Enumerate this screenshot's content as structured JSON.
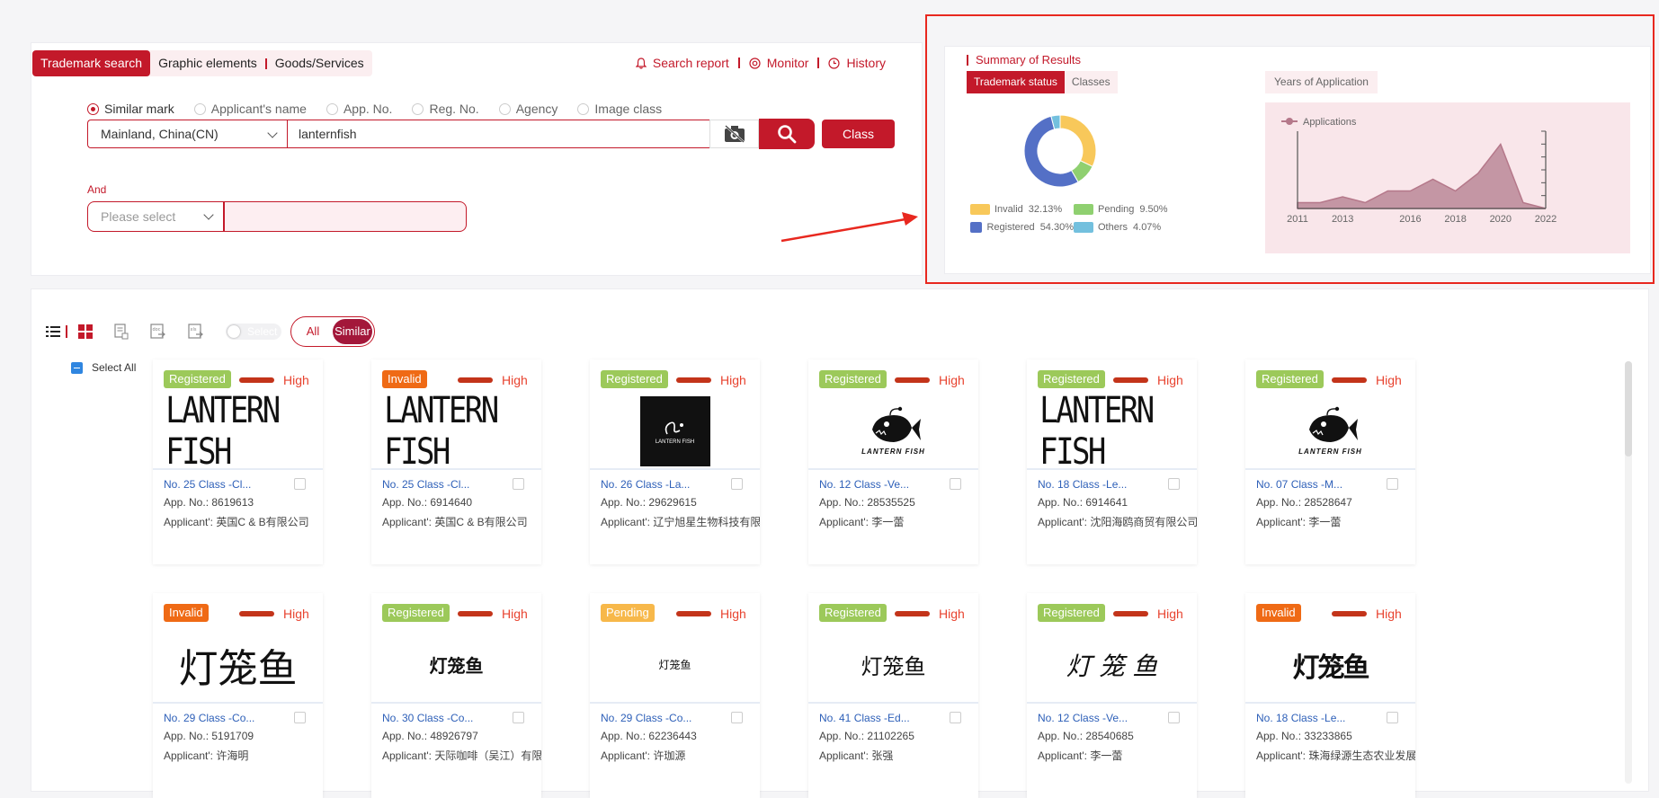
{
  "search": {
    "tabs": [
      "Trademark search",
      "Graphic elements",
      "Goods/Services"
    ],
    "links": [
      "Search report",
      "Monitor",
      "History"
    ],
    "radios": [
      "Similar mark",
      "Applicant's name",
      "App. No.",
      "Reg. No.",
      "Agency",
      "Image class"
    ],
    "region": "Mainland, China(CN)",
    "keyword": "lanternfish",
    "class_button": "Class",
    "and_label": "And",
    "and_placeholder": "Please select"
  },
  "summary": {
    "title": "Summary of Results",
    "tabs": [
      "Trademark status",
      "Classes"
    ],
    "years_tab": "Years of Application",
    "donut": [
      {
        "label": "Invalid",
        "pct": "32.13%",
        "value": 32.13,
        "color": "#f8c85a"
      },
      {
        "label": "Pending",
        "pct": "9.50%",
        "value": 9.5,
        "color": "#8fd070"
      },
      {
        "label": "Registered",
        "pct": "54.30%",
        "value": 54.3,
        "color": "#5470c6"
      },
      {
        "label": "Others",
        "pct": "4.07%",
        "value": 4.07,
        "color": "#73c0de"
      }
    ]
  },
  "chart_data": {
    "type": "area",
    "series": [
      {
        "name": "Applications",
        "values": [
          1,
          1,
          2,
          1,
          3,
          3,
          5,
          3,
          6,
          11,
          1
        ]
      }
    ],
    "x": [
      2011,
      2012,
      2013,
      2014,
      2015,
      2016,
      2017,
      2018,
      2019,
      2020,
      2021,
      2022
    ],
    "xticks": [
      "2011",
      "2013",
      "2016",
      "2018",
      "2020",
      "2022"
    ],
    "color": "#b5788a"
  },
  "results": {
    "filter": [
      "All",
      "Similar"
    ],
    "toggle_label": "Select",
    "select_all": "Select All",
    "high_label": "High",
    "cards": [
      {
        "status": "Registered",
        "color": "#9cc95a",
        "image": "LANTERN FISH",
        "kind": "text-lf",
        "cls": "No. 25 Class -Cl...",
        "app": "App. No.: 8619613",
        "applicant": "Applicant': 英国C & B有限公司"
      },
      {
        "status": "Invalid",
        "color": "#ef6a15",
        "image": "LANTERN FISH",
        "kind": "text-lf",
        "cls": "No. 25 Class -Cl...",
        "app": "App. No.: 6914640",
        "applicant": "Applicant': 英国C & B有限公司"
      },
      {
        "status": "Registered",
        "color": "#9cc95a",
        "image": "LANTERN FISH",
        "kind": "black-logo",
        "cls": "No. 26 Class -La...",
        "app": "App. No.: 29629615",
        "applicant": "Applicant': 辽宁旭星生物科技有限"
      },
      {
        "status": "Registered",
        "color": "#9cc95a",
        "image": "LANTERN FISH",
        "kind": "fish",
        "cls": "No. 12 Class -Ve...",
        "app": "App. No.: 28535525",
        "applicant": "Applicant': 李一蕾"
      },
      {
        "status": "Registered",
        "color": "#9cc95a",
        "image": "LANTERN FISH",
        "kind": "text-lf",
        "cls": "No. 18 Class -Le...",
        "app": "App. No.: 6914641",
        "applicant": "Applicant': 沈阳海鸥商贸有限公司"
      },
      {
        "status": "Registered",
        "color": "#9cc95a",
        "image": "LANTERN FISH",
        "kind": "fish",
        "cls": "No. 07 Class -M...",
        "app": "App. No.: 28528647",
        "applicant": "Applicant': 李一蕾"
      },
      {
        "status": "Invalid",
        "color": "#ef6a15",
        "image": "灯笼鱼",
        "kind": "cn-big",
        "cls": "No. 29 Class -Co...",
        "app": "App. No.: 5191709",
        "applicant": "Applicant': 许海明"
      },
      {
        "status": "Registered",
        "color": "#9cc95a",
        "image": "灯笼鱼",
        "kind": "cn-mid",
        "cls": "No. 30 Class -Co...",
        "app": "App. No.: 48926797",
        "applicant": "Applicant': 天际咖啡（吴江）有限"
      },
      {
        "status": "Pending",
        "color": "#f7b84a",
        "image": "灯笼鱼",
        "kind": "cn-small",
        "cls": "No. 29 Class -Co...",
        "app": "App. No.: 62236443",
        "applicant": "Applicant': 许珈源"
      },
      {
        "status": "Registered",
        "color": "#9cc95a",
        "image": "灯笼鱼",
        "kind": "cn-light",
        "cls": "No. 41 Class -Ed...",
        "app": "App. No.: 21102265",
        "applicant": "Applicant': 张强"
      },
      {
        "status": "Registered",
        "color": "#9cc95a",
        "image": "灯 笼 鱼",
        "kind": "cn-italic",
        "cls": "No. 12 Class -Ve...",
        "app": "App. No.: 28540685",
        "applicant": "Applicant': 李一蕾"
      },
      {
        "status": "Invalid",
        "color": "#ef6a15",
        "image": "灯笼鱼",
        "kind": "cn-bold",
        "cls": "No. 18 Class -Le...",
        "app": "App. No.: 33233865",
        "applicant": "Applicant': 珠海绿源生态农业发展"
      }
    ]
  }
}
